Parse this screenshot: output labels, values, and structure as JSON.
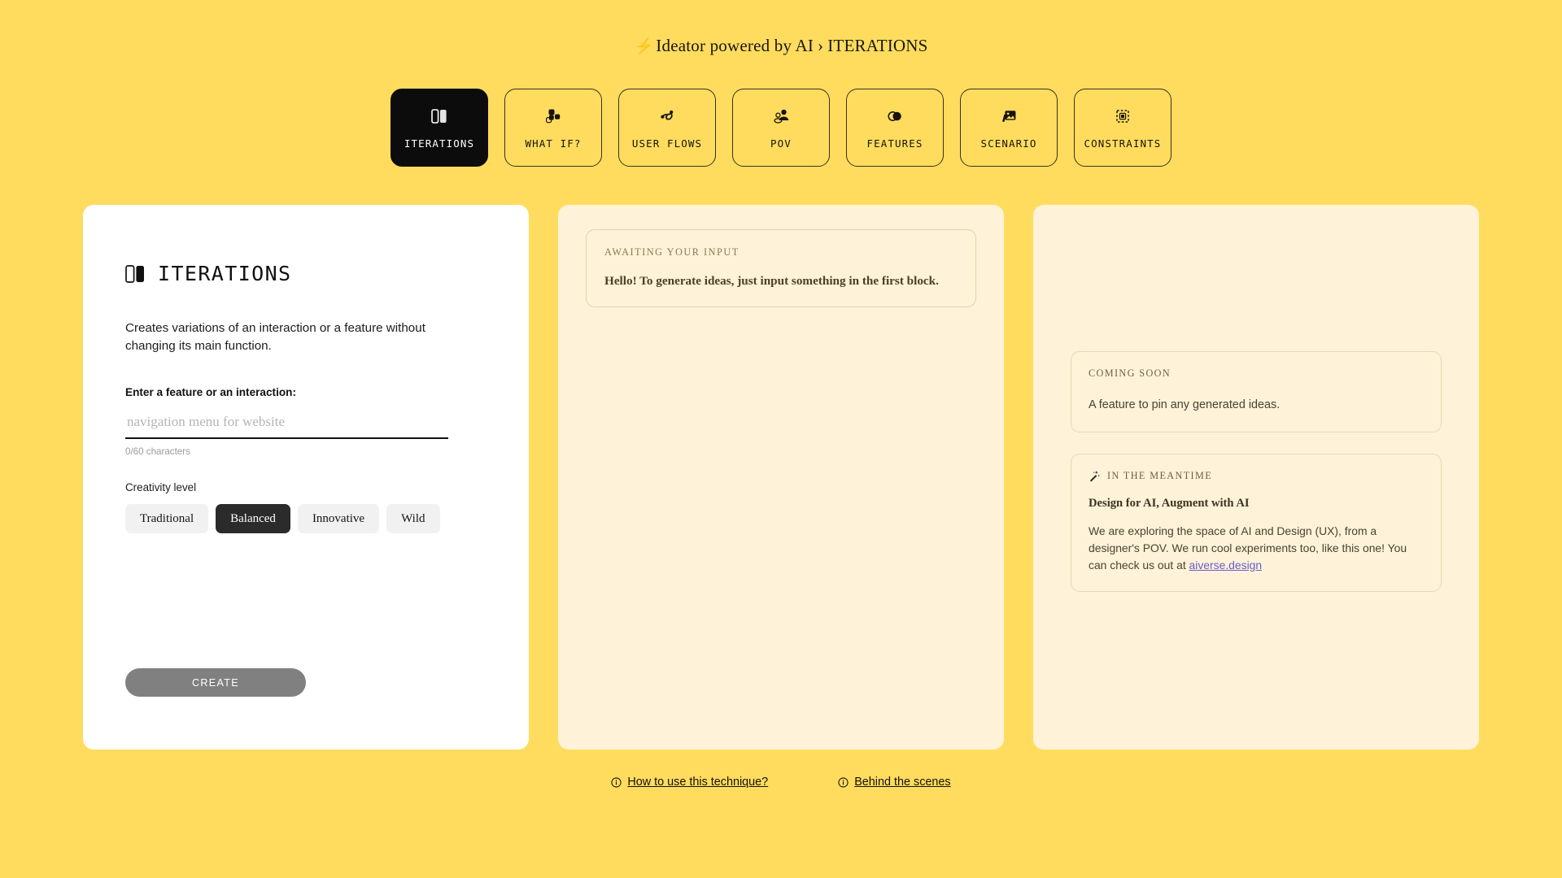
{
  "header": {
    "bolt_icon": "lightning-bolt-icon",
    "app_name": "Ideator powered by AI",
    "separator": "›",
    "current_section": "ITERATIONS"
  },
  "tabs": [
    {
      "label": "ITERATIONS",
      "icon": "two-panels-icon",
      "active": true
    },
    {
      "label": "WHAT IF?",
      "icon": "scattered-squares-icon",
      "active": false
    },
    {
      "label": "USER FLOWS",
      "icon": "flow-path-icon",
      "active": false
    },
    {
      "label": "POV",
      "icon": "two-people-icon",
      "active": false
    },
    {
      "label": "FEATURES",
      "icon": "venn-circles-icon",
      "active": false
    },
    {
      "label": "SCENARIO",
      "icon": "image-stack-icon",
      "active": false
    },
    {
      "label": "CONSTRAINTS",
      "icon": "dashed-square-icon",
      "active": false
    }
  ],
  "left_panel": {
    "title": "ITERATIONS",
    "title_icon": "two-panels-icon",
    "description": "Creates variations of an interaction or a feature without changing its main function.",
    "field_label": "Enter a feature or an interaction:",
    "input_value": "",
    "input_placeholder": "navigation menu for website",
    "char_count": "0/60 characters",
    "creativity_label": "Creativity level",
    "creativity_options": [
      {
        "label": "Traditional",
        "selected": false
      },
      {
        "label": "Balanced",
        "selected": true
      },
      {
        "label": "Innovative",
        "selected": false
      },
      {
        "label": "Wild",
        "selected": false
      }
    ],
    "create_button": "CREATE"
  },
  "middle_panel": {
    "kicker": "AWAITING YOUR INPUT",
    "message": "Hello! To generate ideas, just input something in the first block."
  },
  "right_panel": {
    "coming_soon": {
      "kicker": "COMING SOON",
      "text": "A feature to pin any generated ideas."
    },
    "meantime": {
      "icon": "magic-wand-icon",
      "kicker": "IN THE MEANTIME",
      "heading": "Design for AI, Augment with AI",
      "paragraph_before_link": "We are exploring the space of AI and Design (UX), from a designer's POV. We run cool experiments too, like this one! You can check us out at ",
      "link_text": "aiverse.design"
    }
  },
  "footer": {
    "links": [
      {
        "label": "How to use this technique?",
        "icon": "info-icon"
      },
      {
        "label": "Behind the scenes",
        "icon": "info-icon"
      }
    ]
  },
  "colors": {
    "background": "#ffdc5e",
    "panel_white": "#ffffff",
    "panel_cream": "#fef3d8",
    "active_tab": "#0c0c0c",
    "chip_selected": "#2b2b2b",
    "create_disabled": "#808080",
    "link_purple": "#6a5acd"
  }
}
